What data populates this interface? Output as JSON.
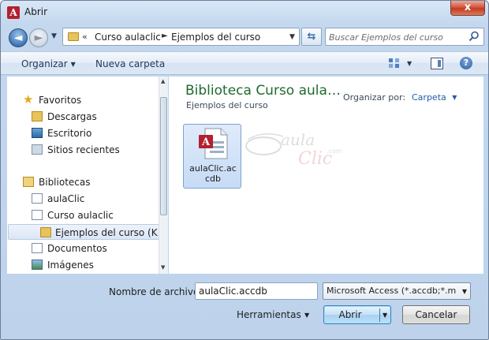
{
  "window": {
    "title": "Abrir",
    "app_icon": "A",
    "close": "x"
  },
  "address": {
    "back_icon": "◄",
    "chevron": "«",
    "crumbs": [
      "Curso aulaclic",
      "Ejemplos del curso"
    ],
    "separator": "►",
    "search_placeholder": "Buscar Ejemplos del curso"
  },
  "toolbar": {
    "organize": "Organizar",
    "new_folder": "Nueva carpeta",
    "help": "?"
  },
  "nav": {
    "favorites_label": "Favoritos",
    "favorites": [
      "Descargas",
      "Escritorio",
      "Sitios recientes"
    ],
    "libraries_label": "Bibliotecas",
    "libraries": [
      "aulaClic",
      "Curso aulaclic",
      "Ejemplos del curso (K:)",
      "Documentos",
      "Imágenes"
    ]
  },
  "content": {
    "title": "Biblioteca Curso aula…",
    "subtitle": "Ejemplos del curso",
    "arrange_label": "Organizar por:",
    "arrange_value": "Carpeta",
    "file": {
      "name": "aulaClic.accdb",
      "name_line1": "aulaClic.ac",
      "name_line2": "cdb"
    },
    "watermark": {
      "aula": "aula",
      "clic": "Clic",
      "com": ".com"
    }
  },
  "footer": {
    "filename_label": "Nombre de archivo:",
    "filename_value": "aulaClic.accdb",
    "filetype_value": "Microsoft Access (*.accdb;*.mc",
    "tools_label": "Herramientas",
    "open_label": "Abrir",
    "cancel_label": "Cancelar"
  },
  "colors": {
    "accent": "#1f5fa8",
    "library_title": "#1e6b2e",
    "app_icon": "#b3202f",
    "close_button": "#c43a22"
  }
}
